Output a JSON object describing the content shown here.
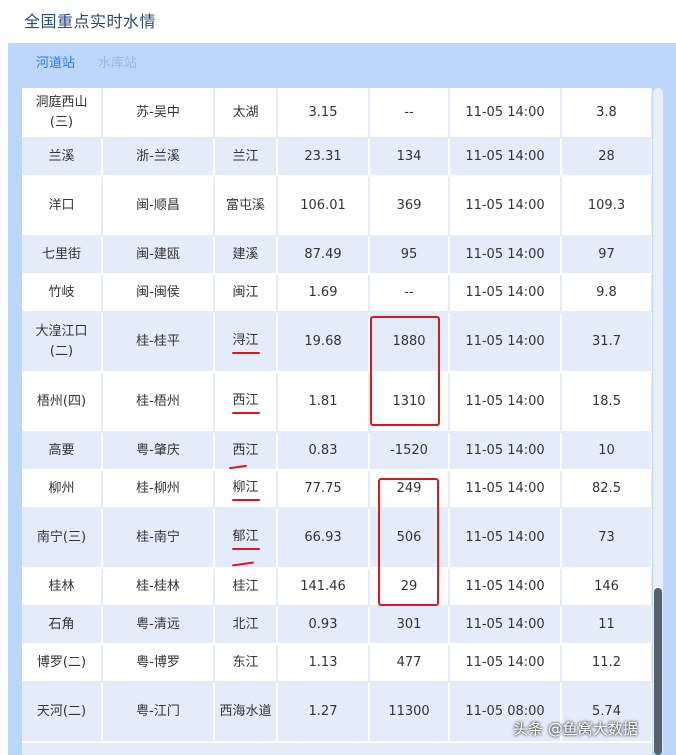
{
  "page_title": "全国重点实时水情",
  "tabs": [
    {
      "label": "河道站",
      "active": true
    },
    {
      "label": "水库站",
      "active": false
    }
  ],
  "rows": [
    {
      "station": "洞庭西山(三)",
      "region": "苏-吴中",
      "river": "太湖",
      "level": "3.15",
      "flow": "--",
      "time": "11-05 14:00",
      "warn": "3.8"
    },
    {
      "station": "兰溪",
      "region": "浙-兰溪",
      "river": "兰江",
      "level": "23.31",
      "flow": "134",
      "time": "11-05 14:00",
      "warn": "28"
    },
    {
      "station": "洋口",
      "region": "闽-顺昌",
      "river": "富屯溪",
      "level": "106.01",
      "flow": "369",
      "time": "11-05 14:00",
      "warn": "109.3"
    },
    {
      "station": "七里街",
      "region": "闽-建瓯",
      "river": "建溪",
      "level": "87.49",
      "flow": "95",
      "time": "11-05 14:00",
      "warn": "97"
    },
    {
      "station": "竹岐",
      "region": "闽-闽侯",
      "river": "闽江",
      "level": "1.69",
      "flow": "--",
      "time": "11-05 14:00",
      "warn": "9.8"
    },
    {
      "station": "大湟江口(二)",
      "region": "桂-桂平",
      "river": "浔江",
      "level": "19.68",
      "flow": "1880",
      "time": "11-05 14:00",
      "warn": "31.7"
    },
    {
      "station": "梧州(四)",
      "region": "桂-梧州",
      "river": "西江",
      "level": "1.81",
      "flow": "1310",
      "time": "11-05 14:00",
      "warn": "18.5"
    },
    {
      "station": "高要",
      "region": "粤-肇庆",
      "river": "西江",
      "level": "0.83",
      "flow": "-1520",
      "time": "11-05 14:00",
      "warn": "10"
    },
    {
      "station": "柳州",
      "region": "桂-柳州",
      "river": "柳江",
      "level": "77.75",
      "flow": "249",
      "time": "11-05 14:00",
      "warn": "82.5"
    },
    {
      "station": "南宁(三)",
      "region": "桂-南宁",
      "river": "郁江",
      "level": "66.93",
      "flow": "506",
      "time": "11-05 14:00",
      "warn": "73"
    },
    {
      "station": "桂林",
      "region": "桂-桂林",
      "river": "桂江",
      "level": "141.46",
      "flow": "29",
      "time": "11-05 14:00",
      "warn": "146"
    },
    {
      "station": "石角",
      "region": "粤-清远",
      "river": "北江",
      "level": "0.93",
      "flow": "301",
      "time": "11-05 14:00",
      "warn": "11"
    },
    {
      "station": "博罗(二)",
      "region": "粤-博罗",
      "river": "东江",
      "level": "1.13",
      "flow": "477",
      "time": "11-05 14:00",
      "warn": "11.2"
    },
    {
      "station": "天河(二)",
      "region": "粤-江门",
      "river": "西海水道",
      "level": "1.27",
      "flow": "11300",
      "time": "11-05 08:00",
      "warn": "5.74"
    }
  ],
  "watermark": "头条 @鱼窝大数据",
  "colors": {
    "accent": "#2b7be3",
    "header_bg": "#bdd7fb",
    "stripe": "#e4ecfa",
    "annotation": "#e0161c"
  }
}
